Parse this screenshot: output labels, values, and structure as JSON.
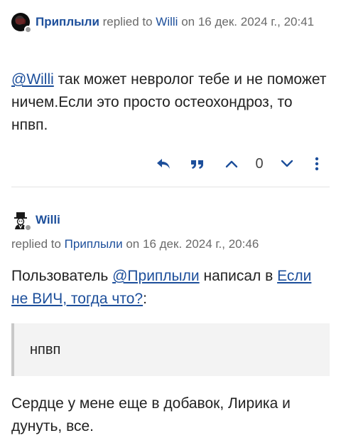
{
  "post1": {
    "author": "Приплыли",
    "replied_to_label": "replied to",
    "replied_to": "Willi",
    "on_label": "on",
    "date": "16 дек. 2024 г., 20:41",
    "mention": "@Willi",
    "text": " так может невролог тебе и не поможет ничем.Если это просто остеохондроз, то нпвп.",
    "actions": {
      "reply_icon": "reply-icon",
      "quote_icon": "quote-icon",
      "upvote_icon": "chevron-up-icon",
      "vote_count": "0",
      "downvote_icon": "chevron-down-icon",
      "more_icon": "more-vertical-icon"
    }
  },
  "post2": {
    "author": "Willi",
    "replied_to_label": "replied to",
    "replied_to": "Приплыли",
    "on_label": "on",
    "date": "16 дек. 2024 г., 20:46",
    "intro_prefix": "Пользователь ",
    "intro_mention": "@Приплыли",
    "intro_middle": " написал в ",
    "intro_topic": "Если не ВИЧ, тогда что?",
    "intro_suffix": ":",
    "quote": "нпвп",
    "text": "Сердце у мене еще в добавок, Лирика и дунуть, все."
  },
  "colors": {
    "link": "#1d4f9b",
    "meta_text": "#6a6a6a",
    "body_text": "#222222",
    "quote_bg": "#f3f3f3",
    "quote_border": "#c8c8c8"
  }
}
